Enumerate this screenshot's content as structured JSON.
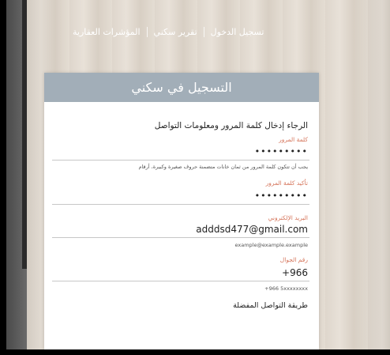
{
  "nav": {
    "items": [
      "المؤشرات العقارية",
      "تقرير سكني",
      "تسجيل الدخول"
    ]
  },
  "card": {
    "title": "التسجيل في سكني",
    "intro": "الرجاء إدخال كلمة المرور ومعلومات التواصل",
    "password": {
      "label": "كلمة المرور",
      "value": "•••••••••",
      "hint": "يجب أن تتكون كلمة المرور من ثمان خانات متضمنة حروف صغيرة وكبيرة، أرقام"
    },
    "confirm": {
      "label": "تأكيد كلمة المرور",
      "value": "•••••••••"
    },
    "email": {
      "label": "البريد الإلكتروني",
      "value": "adddsd477@gmail.com",
      "hint": "example@example.example"
    },
    "phone": {
      "label": "رقم الجوال",
      "value": "+966",
      "hint": "+966 5xxxxxxxx"
    },
    "contact_method": {
      "label": "طريقة التواصل المفضلة"
    }
  },
  "colors": {
    "header_bg": "#a2aeb8",
    "label_accent": "#d5745a"
  }
}
